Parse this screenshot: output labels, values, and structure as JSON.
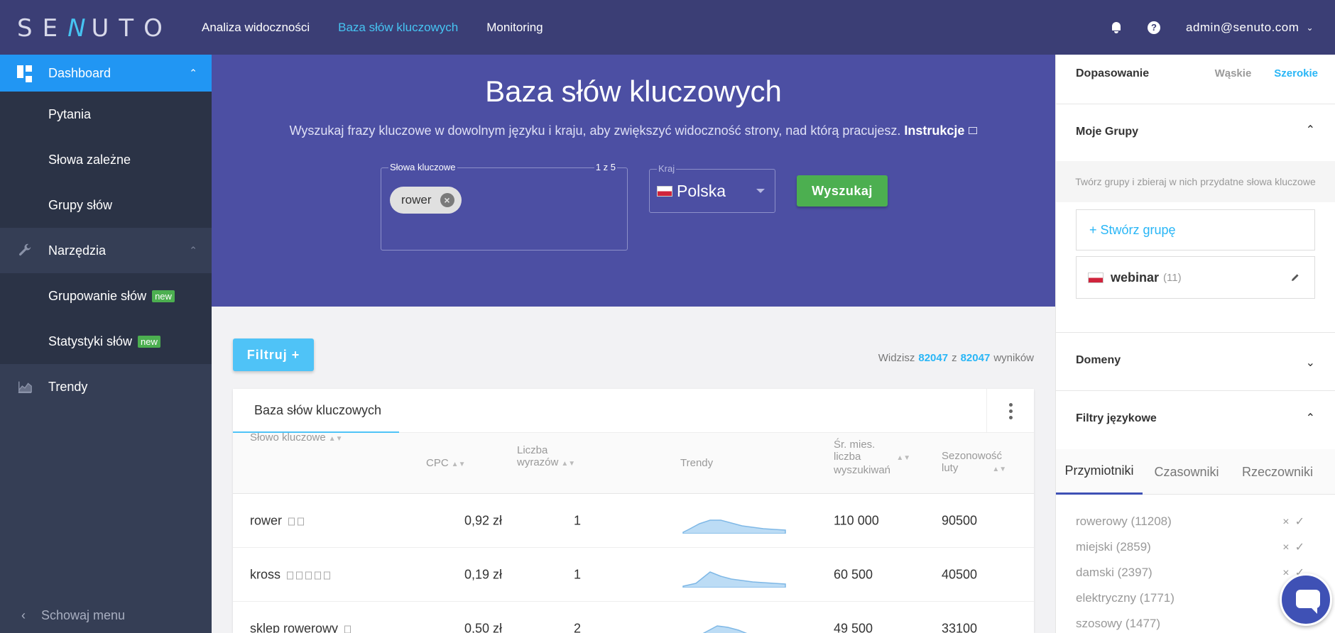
{
  "logo": {
    "text_a": "SE",
    "text_b": "N",
    "text_c": "UTO"
  },
  "nav": {
    "items": [
      {
        "label": "Analiza widoczności"
      },
      {
        "label": "Baza słów kluczowych"
      },
      {
        "label": "Monitoring"
      }
    ],
    "active_index": 1
  },
  "header": {
    "help_glyph": "?",
    "user": "admin@senuto.com"
  },
  "sidebar": {
    "items": [
      {
        "label": "Dashboard"
      },
      {
        "label": "Pytania"
      },
      {
        "label": "Słowa zależne"
      },
      {
        "label": "Grupy słów"
      },
      {
        "label": "Narzędzia"
      },
      {
        "label": "Grupowanie słów",
        "badge": "new"
      },
      {
        "label": "Statystyki słów",
        "badge": "new"
      },
      {
        "label": "Trendy"
      }
    ],
    "hide_menu": "Schowaj menu"
  },
  "hero": {
    "title": "Baza słów kluczowych",
    "subtitle": "Wyszukaj frazy kluczowe w dowolnym języku i kraju, aby zwiększyć widoczność strony, nad którą pracujesz.",
    "instructions_link": "Instrukcje",
    "keywords_label": "Słowa kluczowe",
    "keywords_count": "1 z 5",
    "chip": "rower",
    "country_label": "Kraj",
    "country_value": "Polska",
    "search_button": "Wyszukaj"
  },
  "filter_button": "Filtruj +",
  "results": {
    "prefix": "Widzisz",
    "shown": "82047",
    "mid": "z",
    "total": "82047",
    "suffix": "wyników"
  },
  "table": {
    "tab": "Baza słów kluczowych",
    "columns": {
      "keyword": "Słowo kluczowe",
      "cpc": "CPC",
      "words_a": "Liczba",
      "words_b": "wyrazów",
      "trends": "Trendy",
      "avg_a": "Śr. mies.",
      "avg_b": "liczba",
      "avg_c": "wyszukiwań",
      "season_a": "Sezonowość",
      "season_b": "luty"
    },
    "rows": [
      {
        "keyword": "rower",
        "cpc": "0,92 zł",
        "words": "1",
        "searches": "110 000",
        "season": "90500"
      },
      {
        "keyword": "kross",
        "cpc": "0,19 zł",
        "words": "1",
        "searches": "60 500",
        "season": "40500"
      },
      {
        "keyword": "sklep rowerowy",
        "cpc": "0,50 zł",
        "words": "2",
        "searches": "49 500",
        "season": "33100"
      }
    ]
  },
  "right_panel": {
    "matching": {
      "title": "Dopasowanie",
      "narrow": "Wąskie",
      "broad": "Szerokie"
    },
    "groups": {
      "title": "Moje Grupy",
      "hint": "Twórz grupy i zbieraj w nich przydatne słowa kluczowe",
      "create": "+ Stwórz grupę",
      "group_name": "webinar",
      "group_count": "(11)"
    },
    "domains": {
      "title": "Domeny"
    },
    "lang_filters": {
      "title": "Filtry językowe",
      "tabs": [
        "Przymiotniki",
        "Czasowniki",
        "Rzeczowniki"
      ],
      "words": [
        "rowerowy (11208)",
        "miejski (2859)",
        "damski (2397)",
        "elektryczny (1771)",
        "szosowy (1477)"
      ]
    }
  },
  "colors": {
    "topbar": "#3b3e75",
    "hero": "#4c4fa3",
    "accent": "#29b6f6",
    "green": "#4caf50",
    "sidebar": "#353e55",
    "sidebar_active": "#2196f3"
  }
}
